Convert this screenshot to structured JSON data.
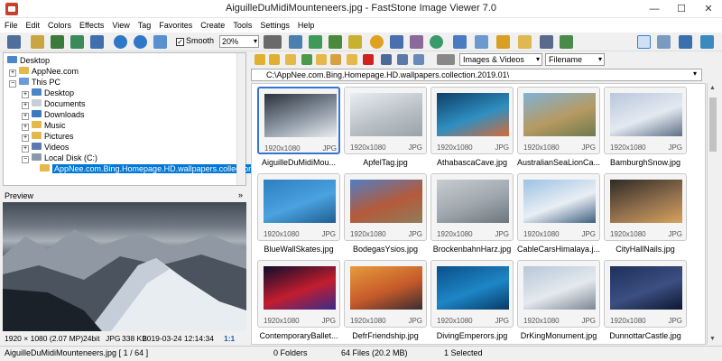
{
  "window": {
    "title": "AiguilleDuMidiMounteneers.jpg  -  FastStone Image Viewer 7.0",
    "minimize": "—",
    "maximize": "☐",
    "close": "✕"
  },
  "menu": [
    "File",
    "Edit",
    "Colors",
    "Effects",
    "View",
    "Tag",
    "Favorites",
    "Create",
    "Tools",
    "Settings",
    "Help"
  ],
  "toolbar": {
    "smooth_label": "Smooth",
    "smooth_checked": "✓",
    "zoom_value": "20%"
  },
  "tree": {
    "items": [
      {
        "label": "Desktop",
        "icon": "desktop-icon"
      },
      {
        "label": "AppNee.com",
        "icon": "user-folder-icon",
        "expander": "+"
      },
      {
        "label": "This PC",
        "icon": "computer-icon",
        "expander": "−"
      },
      {
        "label": "Desktop",
        "icon": "folder-icon",
        "expander": "+"
      },
      {
        "label": "Documents",
        "icon": "folder-icon",
        "expander": "+"
      },
      {
        "label": "Downloads",
        "icon": "folder-icon",
        "expander": "+"
      },
      {
        "label": "Music",
        "icon": "folder-icon",
        "expander": "+"
      },
      {
        "label": "Pictures",
        "icon": "folder-icon",
        "expander": "+"
      },
      {
        "label": "Videos",
        "icon": "folder-icon",
        "expander": "+"
      },
      {
        "label": "Local Disk (C:)",
        "icon": "drive-icon",
        "expander": "−"
      },
      {
        "label": "AppNee.com.Bing.Homepage.HD.wallpapers.collection",
        "icon": "folder-open-icon"
      }
    ]
  },
  "preview": {
    "label": "Preview",
    "collapse": "»",
    "info": {
      "dimensions": "1920 × 1080 (2.07 MP)",
      "depth": "24bit",
      "format": "JPG",
      "size": "338 KB",
      "date": "2019-03-24 12:14:34",
      "ratio": "1:1"
    }
  },
  "browser": {
    "filter": "Images & Videos",
    "sort": "Filename",
    "path": "C:\\AppNee.com.Bing.Homepage.HD.wallpapers.collection.2019.01\\",
    "thumbnails": [
      {
        "name": "AiguilleDuMidiMou...",
        "res": "1920x1080",
        "fmt": "JPG",
        "selected": true,
        "colors": [
          "#2b333c",
          "#8d98a4",
          "#e8ecf0"
        ]
      },
      {
        "name": "ApfelTag.jpg",
        "res": "1920x1080",
        "fmt": "JPG",
        "colors": [
          "#e9edf1",
          "#b9c1c7",
          "#9aa3aa"
        ]
      },
      {
        "name": "AthabascaCave.jpg",
        "res": "1920x1080",
        "fmt": "JPG",
        "colors": [
          "#0e3f68",
          "#2f8fc0",
          "#d46b39"
        ]
      },
      {
        "name": "AustralianSeaLionCa...",
        "res": "1920x1080",
        "fmt": "JPG",
        "colors": [
          "#7fb2d7",
          "#b79a62",
          "#6d7a4e"
        ]
      },
      {
        "name": "BamburghSnow.jpg",
        "res": "1920x1080",
        "fmt": "JPG",
        "colors": [
          "#b9c8dc",
          "#e3e9f1",
          "#5e6f86"
        ]
      },
      {
        "name": "BlueWallSkates.jpg",
        "res": "1920x1080",
        "fmt": "JPG",
        "colors": [
          "#2d7fbf",
          "#4aa2df",
          "#1f5d92"
        ]
      },
      {
        "name": "BodegasYsios.jpg",
        "res": "1920x1080",
        "fmt": "JPG",
        "colors": [
          "#4f7fc2",
          "#b55a3a",
          "#8f7d5c"
        ]
      },
      {
        "name": "BrockenbahnHarz.jpg",
        "res": "1920x1080",
        "fmt": "JPG",
        "colors": [
          "#c8ccd1",
          "#9ea6ad",
          "#6d757d"
        ]
      },
      {
        "name": "CableCarsHimalaya.j...",
        "res": "1920x1080",
        "fmt": "JPG",
        "colors": [
          "#9cc2e3",
          "#e8eef4",
          "#3f5f80"
        ]
      },
      {
        "name": "CityHallNails.jpg",
        "res": "1920x1080",
        "fmt": "JPG",
        "colors": [
          "#2f2a25",
          "#8f6e4c",
          "#d6a35c"
        ]
      },
      {
        "name": "ContemporaryBallet...",
        "res": "1920x1080",
        "fmt": "JPG",
        "colors": [
          "#0d0d2a",
          "#c21d2e",
          "#3a2a8c"
        ]
      },
      {
        "name": "DefrFriendship.jpg",
        "res": "1920x1080",
        "fmt": "JPG",
        "colors": [
          "#e79a3c",
          "#c65a2a",
          "#3a2c32"
        ]
      },
      {
        "name": "DivingEmperors.jpg",
        "res": "1920x1080",
        "fmt": "JPG",
        "colors": [
          "#0a4f88",
          "#1e86c6",
          "#073a66"
        ]
      },
      {
        "name": "DrKingMonument.jpg",
        "res": "1920x1080",
        "fmt": "JPG",
        "colors": [
          "#b7c7d8",
          "#e4e9ee",
          "#7c8794"
        ]
      },
      {
        "name": "DunnottarCastle.jpg",
        "res": "1920x1080",
        "fmt": "JPG",
        "colors": [
          "#1d2f5a",
          "#3c4f82",
          "#0d1730"
        ]
      }
    ]
  },
  "status": {
    "file": "AiguilleDuMidiMounteneers.jpg [ 1 / 64 ]",
    "folders": "0 Folders",
    "files": "64 Files (20.2 MB)",
    "selected": "1 Selected"
  },
  "colors": {
    "selection": "#0078d7",
    "thumb_selected_border": "#3574d4",
    "folder": "#e5b84a"
  }
}
